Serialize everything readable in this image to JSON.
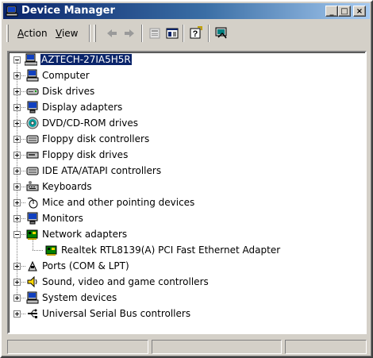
{
  "window": {
    "title": "Device Manager",
    "controls": {
      "minimize": "_",
      "maximize": "□",
      "close": "×"
    }
  },
  "menu": {
    "action": {
      "prefix": "",
      "accel": "A",
      "rest": "ction"
    },
    "view": {
      "prefix": "",
      "accel": "V",
      "rest": "iew"
    }
  },
  "toolbar_icons": [
    "back-arrow-icon",
    "forward-arrow-icon",
    "properties-list-icon",
    "console-tree-icon",
    "help-icon",
    "scan-hardware-icon"
  ],
  "tree": {
    "root": "AZTECH-27IA5H5R",
    "categories": [
      {
        "label": "Computer",
        "icon": "computer-icon",
        "expanded": false
      },
      {
        "label": "Disk drives",
        "icon": "disk-drive-icon",
        "expanded": false
      },
      {
        "label": "Display adapters",
        "icon": "monitor-icon",
        "expanded": false
      },
      {
        "label": "DVD/CD-ROM drives",
        "icon": "cdrom-icon",
        "expanded": false
      },
      {
        "label": "Floppy disk controllers",
        "icon": "controller-icon",
        "expanded": false
      },
      {
        "label": "Floppy disk drives",
        "icon": "floppy-drive-icon",
        "expanded": false
      },
      {
        "label": "IDE ATA/ATAPI controllers",
        "icon": "controller-icon",
        "expanded": false
      },
      {
        "label": "Keyboards",
        "icon": "keyboard-icon",
        "expanded": false
      },
      {
        "label": "Mice and other pointing devices",
        "icon": "mouse-icon",
        "expanded": false
      },
      {
        "label": "Monitors",
        "icon": "monitor-icon",
        "expanded": false
      },
      {
        "label": "Network adapters",
        "icon": "network-card-icon",
        "expanded": true
      },
      {
        "label": "Ports (COM & LPT)",
        "icon": "port-icon",
        "expanded": false
      },
      {
        "label": "Sound, video and game controllers",
        "icon": "speaker-icon",
        "expanded": false
      },
      {
        "label": "System devices",
        "icon": "computer-icon",
        "expanded": false
      },
      {
        "label": "Universal Serial Bus controllers",
        "icon": "usb-icon",
        "expanded": false
      }
    ],
    "network_child": "Realtek RTL8139(A) PCI Fast Ethernet Adapter"
  },
  "statusbar": {
    "cells": [
      "",
      "",
      ""
    ]
  },
  "colors": {
    "title_start": "#0a246a",
    "title_end": "#a6caf0",
    "selection": "#0a246a",
    "face": "#d4d0c8"
  }
}
